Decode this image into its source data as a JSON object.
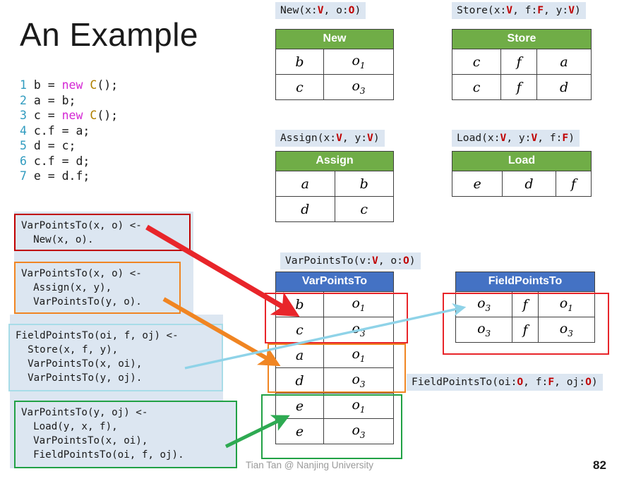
{
  "slide": {
    "title": "An Example",
    "footer_author": "Tian Tan @ Nanjing University",
    "page_number": "82"
  },
  "code": {
    "lines": [
      {
        "n": "1",
        "text": "b = new C();"
      },
      {
        "n": "2",
        "text": "a = b;"
      },
      {
        "n": "3",
        "text": "c = new C();"
      },
      {
        "n": "4",
        "text": "c.f = a;"
      },
      {
        "n": "5",
        "text": "d = c;"
      },
      {
        "n": "6",
        "text": "c.f = d;"
      },
      {
        "n": "7",
        "text": "e = d.f;"
      }
    ]
  },
  "rules": [
    {
      "id": "new-rule",
      "color": "#c00000",
      "text": "VarPointsTo(x, o) <-\n  New(x, o)."
    },
    {
      "id": "assign-rule",
      "color": "#f08522",
      "text": "VarPointsTo(x, o) <-\n  Assign(x, y),\n  VarPointsTo(y, o)."
    },
    {
      "id": "store-rule",
      "color": "#a8dce8",
      "text": "FieldPointsTo(oi, f, oj) <-\n  Store(x, f, y),\n  VarPointsTo(x, oi),\n  VarPointsTo(y, oj)."
    },
    {
      "id": "load-rule",
      "color": "#21a145",
      "text": "VarPointsTo(y, oj) <-\n  Load(y, x, f),\n  VarPointsTo(x, oi),\n  FieldPointsTo(oi, f, oj)."
    }
  ],
  "captions": {
    "new": [
      {
        "t": "New(x:",
        "k": "p"
      },
      {
        "t": "V",
        "k": "t"
      },
      {
        "t": ", o:",
        "k": "p"
      },
      {
        "t": "O",
        "k": "t"
      },
      {
        "t": ")",
        "k": "p"
      }
    ],
    "store": [
      {
        "t": "Store(x:",
        "k": "p"
      },
      {
        "t": "V",
        "k": "t"
      },
      {
        "t": ", f:",
        "k": "p"
      },
      {
        "t": "F",
        "k": "t"
      },
      {
        "t": ", y:",
        "k": "p"
      },
      {
        "t": "V",
        "k": "t"
      },
      {
        "t": ")",
        "k": "p"
      }
    ],
    "assign": [
      {
        "t": "Assign(x:",
        "k": "p"
      },
      {
        "t": "V",
        "k": "t"
      },
      {
        "t": ", y:",
        "k": "p"
      },
      {
        "t": "V",
        "k": "t"
      },
      {
        "t": ")",
        "k": "p"
      }
    ],
    "load": [
      {
        "t": "Load(x:",
        "k": "p"
      },
      {
        "t": "V",
        "k": "t"
      },
      {
        "t": ", y:",
        "k": "p"
      },
      {
        "t": "V",
        "k": "t"
      },
      {
        "t": ", f:",
        "k": "p"
      },
      {
        "t": "F",
        "k": "t"
      },
      {
        "t": ")",
        "k": "p"
      }
    ],
    "varpointsto": [
      {
        "t": "VarPointsTo(v:",
        "k": "p"
      },
      {
        "t": "V",
        "k": "t"
      },
      {
        "t": ", o:",
        "k": "p"
      },
      {
        "t": "O",
        "k": "t"
      },
      {
        "t": ")",
        "k": "p"
      }
    ],
    "fieldpointsto": [
      {
        "t": "FieldPointsTo(oi:",
        "k": "p"
      },
      {
        "t": "O",
        "k": "t"
      },
      {
        "t": ", f:",
        "k": "p"
      },
      {
        "t": "F",
        "k": "t"
      },
      {
        "t": ", oj:",
        "k": "p"
      },
      {
        "t": "O",
        "k": "t"
      },
      {
        "t": ")",
        "k": "p"
      }
    ]
  },
  "tables": {
    "new": {
      "header": "New",
      "header_color": "#70ad47",
      "cols": 2,
      "rows": [
        [
          "b",
          "o₁"
        ],
        [
          "c",
          "o₃"
        ]
      ]
    },
    "store": {
      "header": "Store",
      "header_color": "#70ad47",
      "cols": 3,
      "rows": [
        [
          "c",
          "f",
          "a"
        ],
        [
          "c",
          "f",
          "d"
        ]
      ]
    },
    "assign": {
      "header": "Assign",
      "header_color": "#70ad47",
      "cols": 2,
      "rows": [
        [
          "a",
          "b"
        ],
        [
          "d",
          "c"
        ]
      ]
    },
    "load": {
      "header": "Load",
      "header_color": "#70ad47",
      "cols": 3,
      "rows": [
        [
          "e",
          "d",
          "f"
        ]
      ]
    },
    "varpointsto": {
      "header": "VarPointsTo",
      "header_color": "#4472c4",
      "cols": 2,
      "rows": [
        [
          "b",
          "o₁"
        ],
        [
          "c",
          "o₃"
        ],
        [
          "a",
          "o₁"
        ],
        [
          "d",
          "o₃"
        ],
        [
          "e",
          "o₁"
        ],
        [
          "e",
          "o₃"
        ]
      ]
    },
    "fieldpointsto": {
      "header": "FieldPointsTo",
      "header_color": "#4472c4",
      "cols": 3,
      "rows": [
        [
          "o₃",
          "f",
          "o₁"
        ],
        [
          "o₃",
          "f",
          "o₃"
        ]
      ]
    }
  },
  "colors": {
    "red": "#e8252a",
    "orange": "#f08522",
    "lightblue": "#8fd3e8",
    "green": "#21a145",
    "dark_red_border": "#c00000",
    "rule_bg": "#dce6f1",
    "green_header": "#70ad47",
    "blue_header": "#4472c4"
  }
}
